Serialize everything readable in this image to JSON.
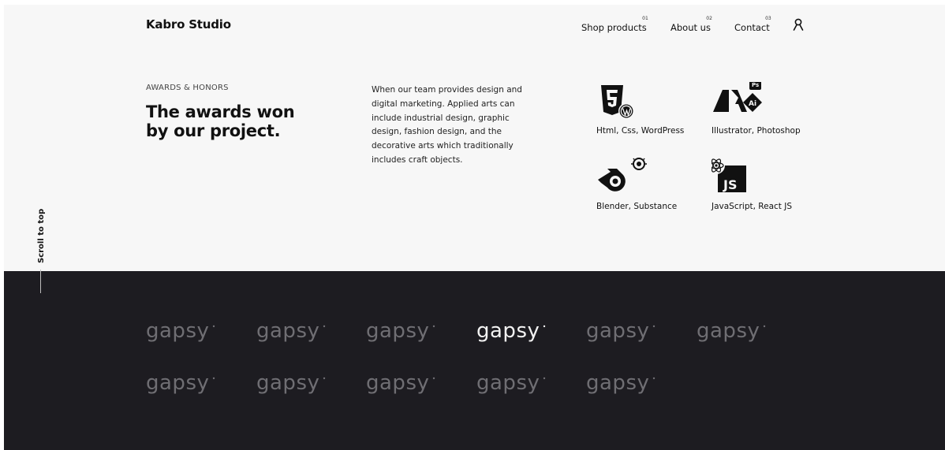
{
  "header": {
    "brand": "Kabro Studio",
    "nav": [
      {
        "num": "01",
        "label": "Shop products"
      },
      {
        "num": "02",
        "label": "About us"
      },
      {
        "num": "03",
        "label": "Contact"
      }
    ],
    "user_icon": "user-icon"
  },
  "awards": {
    "eyebrow": "AWARDS & HONORS",
    "headline_line1": "The awards won",
    "headline_line2": "by our project.",
    "description": "When our team provides design and digital marketing. Applied arts can include industrial design, graphic design, fashion design, and the decorative arts which traditionally includes craft objects."
  },
  "skills": [
    {
      "icon": "html5-wordpress-icon",
      "label": "Html, Css, WordPress"
    },
    {
      "icon": "adobe-illustrator-photoshop-icon",
      "label": "Illustrator, Photoshop"
    },
    {
      "icon": "blender-substance-icon",
      "label": "Blender, Substance"
    },
    {
      "icon": "react-javascript-icon",
      "label": "JavaScript, React JS"
    }
  ],
  "scroll_to_top": "Scroll to top",
  "client_logos": {
    "text": "gapsy",
    "count": 11,
    "highlighted_index": 3,
    "colors": {
      "normal": "#6f6e73",
      "highlight": "#f2f2f2",
      "background": "#1d1c21"
    }
  }
}
